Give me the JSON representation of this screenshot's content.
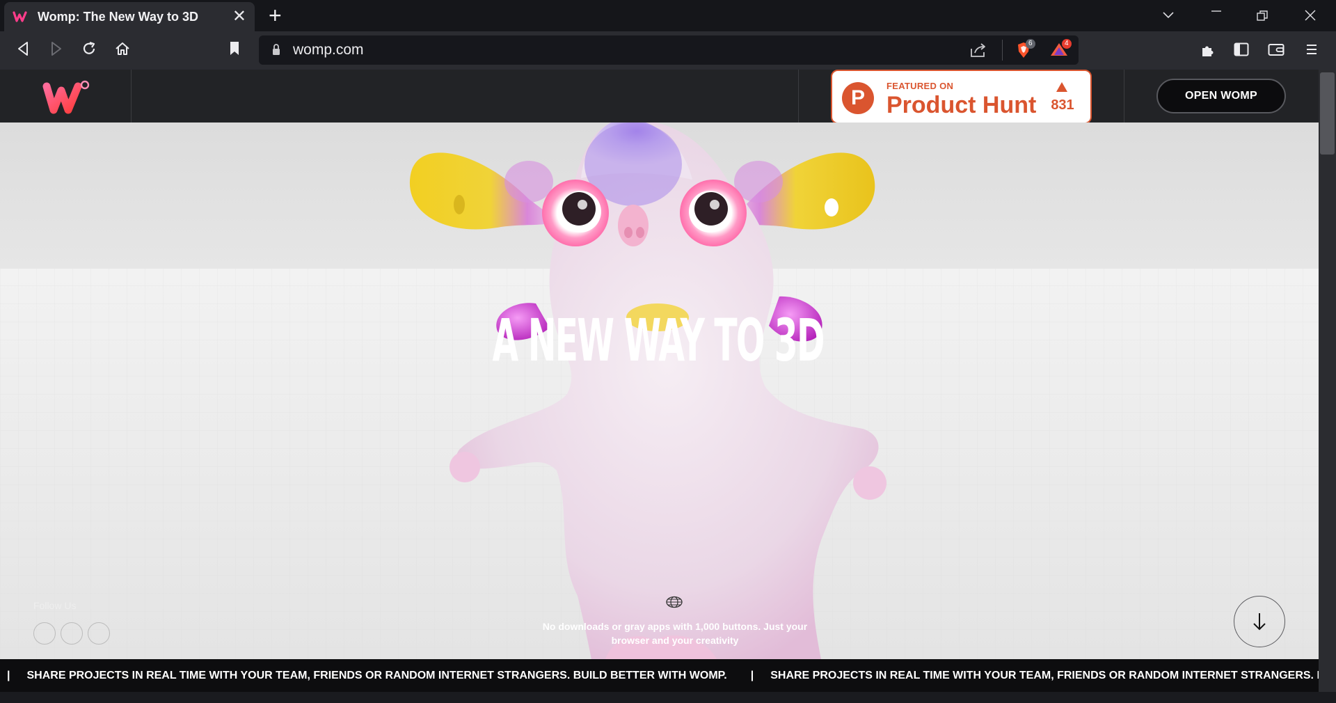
{
  "browser": {
    "tab_title": "Womp: The New Way to 3D",
    "url": "womp.com",
    "shields_count": "6",
    "rewards_count": "4"
  },
  "site": {
    "product_hunt": {
      "featured": "FEATURED ON",
      "name": "Product Hunt",
      "count": "831"
    },
    "open_button": "OPEN WOMP",
    "hero_title": "A NEW WAY TO 3D",
    "description": "No downloads or gray apps with 1,000 buttons. Just your browser and your creativity",
    "follow_label": "Follow Us",
    "ticker": {
      "message": "SHARE PROJECTS IN REAL TIME WITH YOUR TEAM, FRIENDS OR RANDOM INTERNET STRANGERS. BUILD BETTER WITH WOMP.",
      "message_2": "SHARE PROJECTS IN REAL TIME WITH YOUR TEAM, FRIENDS OR RANDOM INTERNET STRANGERS. BUILD BETTER WITH WOMP",
      "separator": "|"
    }
  },
  "colors": {
    "product_hunt": "#da552f",
    "header_bg": "#222326",
    "ticker_bg": "#0d0d0f"
  }
}
